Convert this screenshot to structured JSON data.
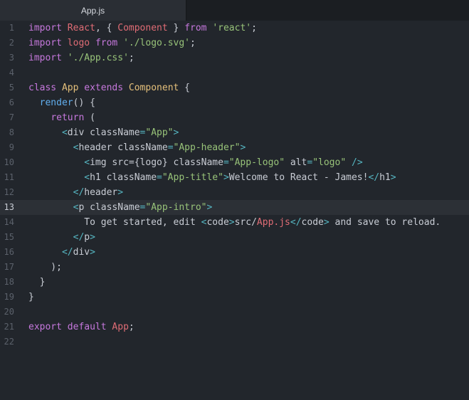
{
  "tab": {
    "label": "App.js"
  },
  "editor": {
    "active_line": 13,
    "colors": {
      "background": "#22262c",
      "keyword": "#c678dd",
      "variable": "#e06c75",
      "class": "#e5c07b",
      "string": "#98c379",
      "tag": "#56b6c2",
      "function": "#61afef",
      "text": "#c8ccd4"
    },
    "lines": [
      {
        "num": "1",
        "tokens": [
          [
            "kw",
            "import"
          ],
          [
            "plain",
            " "
          ],
          [
            "var",
            "React"
          ],
          [
            "plain",
            ", { "
          ],
          [
            "var",
            "Component"
          ],
          [
            "plain",
            " } "
          ],
          [
            "kw",
            "from"
          ],
          [
            "plain",
            " "
          ],
          [
            "str",
            "'react'"
          ],
          [
            "plain",
            ";"
          ]
        ]
      },
      {
        "num": "2",
        "tokens": [
          [
            "kw",
            "import"
          ],
          [
            "plain",
            " "
          ],
          [
            "var",
            "logo"
          ],
          [
            "plain",
            " "
          ],
          [
            "kw",
            "from"
          ],
          [
            "plain",
            " "
          ],
          [
            "str",
            "'./logo.svg'"
          ],
          [
            "plain",
            ";"
          ]
        ]
      },
      {
        "num": "3",
        "tokens": [
          [
            "kw",
            "import"
          ],
          [
            "plain",
            " "
          ],
          [
            "str",
            "'./App.css'"
          ],
          [
            "plain",
            ";"
          ]
        ]
      },
      {
        "num": "4",
        "tokens": []
      },
      {
        "num": "5",
        "tokens": [
          [
            "kw",
            "class"
          ],
          [
            "plain",
            " "
          ],
          [
            "cls",
            "App"
          ],
          [
            "plain",
            " "
          ],
          [
            "kw",
            "extends"
          ],
          [
            "plain",
            " "
          ],
          [
            "cls",
            "Component"
          ],
          [
            "plain",
            " {"
          ]
        ]
      },
      {
        "num": "6",
        "tokens": [
          [
            "plain",
            "  "
          ],
          [
            "fn",
            "render"
          ],
          [
            "plain",
            "() {"
          ]
        ]
      },
      {
        "num": "7",
        "tokens": [
          [
            "plain",
            "    "
          ],
          [
            "kw",
            "return"
          ],
          [
            "plain",
            " ("
          ]
        ]
      },
      {
        "num": "8",
        "tokens": [
          [
            "plain",
            "      "
          ],
          [
            "tag",
            "<"
          ],
          [
            "plain",
            "div className"
          ],
          [
            "tag",
            "="
          ],
          [
            "str",
            "\"App\""
          ],
          [
            "tag",
            ">"
          ]
        ]
      },
      {
        "num": "9",
        "tokens": [
          [
            "plain",
            "        "
          ],
          [
            "tag",
            "<"
          ],
          [
            "plain",
            "header className"
          ],
          [
            "tag",
            "="
          ],
          [
            "str",
            "\"App-header\""
          ],
          [
            "tag",
            ">"
          ]
        ]
      },
      {
        "num": "10",
        "tokens": [
          [
            "plain",
            "          "
          ],
          [
            "tag",
            "<"
          ],
          [
            "plain",
            "img src={logo} className"
          ],
          [
            "tag",
            "="
          ],
          [
            "str",
            "\"App-logo\""
          ],
          [
            "plain",
            " alt"
          ],
          [
            "tag",
            "="
          ],
          [
            "str",
            "\"logo\""
          ],
          [
            "plain",
            " "
          ],
          [
            "tag",
            "/>"
          ]
        ]
      },
      {
        "num": "11",
        "tokens": [
          [
            "plain",
            "          "
          ],
          [
            "tag",
            "<"
          ],
          [
            "plain",
            "h1 className"
          ],
          [
            "tag",
            "="
          ],
          [
            "str",
            "\"App-title\""
          ],
          [
            "tag",
            ">"
          ],
          [
            "plain",
            "Welcome to React - James!"
          ],
          [
            "tag",
            "</"
          ],
          [
            "plain",
            "h1"
          ],
          [
            "tag",
            ">"
          ]
        ]
      },
      {
        "num": "12",
        "tokens": [
          [
            "plain",
            "        "
          ],
          [
            "tag",
            "</"
          ],
          [
            "plain",
            "header"
          ],
          [
            "tag",
            ">"
          ]
        ]
      },
      {
        "num": "13",
        "tokens": [
          [
            "plain",
            "        "
          ],
          [
            "tag",
            "<"
          ],
          [
            "plain",
            "p className"
          ],
          [
            "tag",
            "="
          ],
          [
            "str",
            "\"App-intro\""
          ],
          [
            "tag",
            ">"
          ]
        ]
      },
      {
        "num": "14",
        "tokens": [
          [
            "plain",
            "          To get started, edit "
          ],
          [
            "tag",
            "<"
          ],
          [
            "plain",
            "code"
          ],
          [
            "tag",
            ">"
          ],
          [
            "plain",
            "src/"
          ],
          [
            "var",
            "App.js"
          ],
          [
            "tag",
            "</"
          ],
          [
            "plain",
            "code"
          ],
          [
            "tag",
            ">"
          ],
          [
            "plain",
            " and save to reload."
          ]
        ]
      },
      {
        "num": "15",
        "tokens": [
          [
            "plain",
            "        "
          ],
          [
            "tag",
            "</"
          ],
          [
            "plain",
            "p"
          ],
          [
            "tag",
            ">"
          ]
        ]
      },
      {
        "num": "16",
        "tokens": [
          [
            "plain",
            "      "
          ],
          [
            "tag",
            "</"
          ],
          [
            "plain",
            "div"
          ],
          [
            "tag",
            ">"
          ]
        ]
      },
      {
        "num": "17",
        "tokens": [
          [
            "plain",
            "    );"
          ]
        ]
      },
      {
        "num": "18",
        "tokens": [
          [
            "plain",
            "  }"
          ]
        ]
      },
      {
        "num": "19",
        "tokens": [
          [
            "plain",
            "}"
          ]
        ]
      },
      {
        "num": "20",
        "tokens": []
      },
      {
        "num": "21",
        "tokens": [
          [
            "kw",
            "export"
          ],
          [
            "plain",
            " "
          ],
          [
            "kw",
            "default"
          ],
          [
            "plain",
            " "
          ],
          [
            "var",
            "App"
          ],
          [
            "plain",
            ";"
          ]
        ]
      },
      {
        "num": "22",
        "tokens": []
      }
    ]
  }
}
